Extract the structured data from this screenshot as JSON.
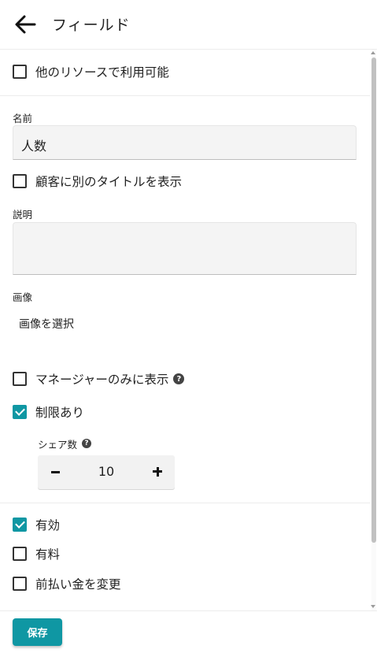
{
  "header": {
    "title": "フィールド",
    "back_icon": "arrow-left-icon"
  },
  "fields": {
    "available_other_resources": {
      "label": "他のリソースで利用可能",
      "checked": false
    },
    "name": {
      "label": "名前",
      "value": "人数"
    },
    "show_different_title": {
      "label": "顧客に別のタイトルを表示",
      "checked": false
    },
    "description": {
      "label": "説明",
      "value": ""
    },
    "image": {
      "label": "画像",
      "select_label": "画像を選択"
    },
    "managers_only": {
      "label": "マネージャーのみに表示",
      "checked": false,
      "help_icon": "question-circle-icon"
    },
    "limited": {
      "label": "制限あり",
      "checked": true
    },
    "share_count": {
      "label": "シェア数",
      "value": "10",
      "help_icon": "question-circle-icon"
    },
    "enabled": {
      "label": "有効",
      "checked": true
    },
    "paid": {
      "label": "有料",
      "checked": false
    },
    "change_prepayment": {
      "label": "前払い金を変更",
      "checked": false
    }
  },
  "footer": {
    "save_label": "保存"
  },
  "colors": {
    "accent": "#0f97a3",
    "input_bg": "#f4f4f4"
  }
}
